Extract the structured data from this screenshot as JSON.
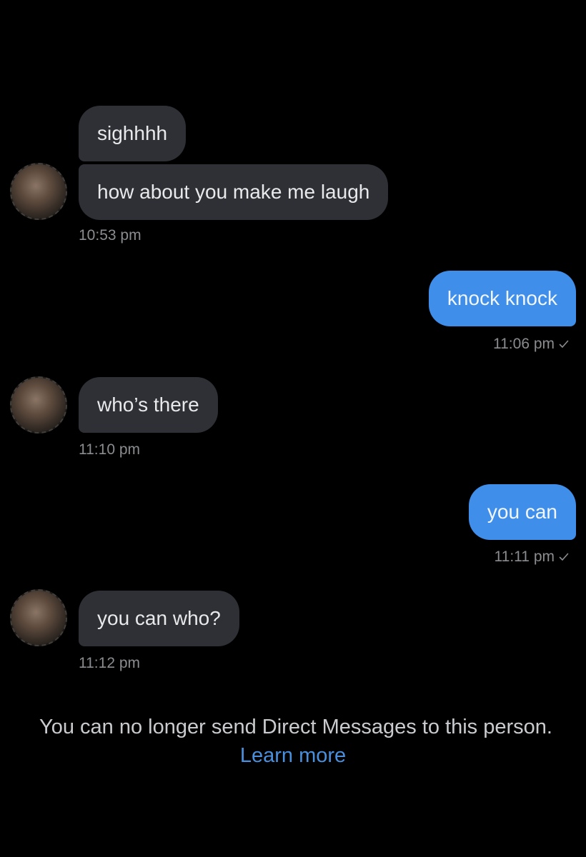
{
  "conversation": {
    "messages": [
      {
        "direction": "in",
        "text": "sighhhh"
      },
      {
        "direction": "in",
        "text": "how about you make me laugh",
        "time": "10:53 pm"
      },
      {
        "direction": "out",
        "text": "knock knock",
        "time": "11:06 pm"
      },
      {
        "direction": "in",
        "text": "who’s there",
        "time": "11:10 pm"
      },
      {
        "direction": "out",
        "text": "you can",
        "time": "11:11 pm"
      },
      {
        "direction": "in",
        "text": "you can who?",
        "time": "11:12 pm"
      }
    ]
  },
  "footer": {
    "notice": "You can no longer send Direct Messages to this person.",
    "learn_more": "Learn more"
  },
  "icons": {
    "sent_status": "checkmark-icon",
    "avatar": "avatar"
  },
  "colors": {
    "background": "#000000",
    "incoming_bubble": "#2e3035",
    "outgoing_bubble": "#3f8eea",
    "link": "#4a8fdc",
    "timestamp": "#8a8c8f"
  }
}
